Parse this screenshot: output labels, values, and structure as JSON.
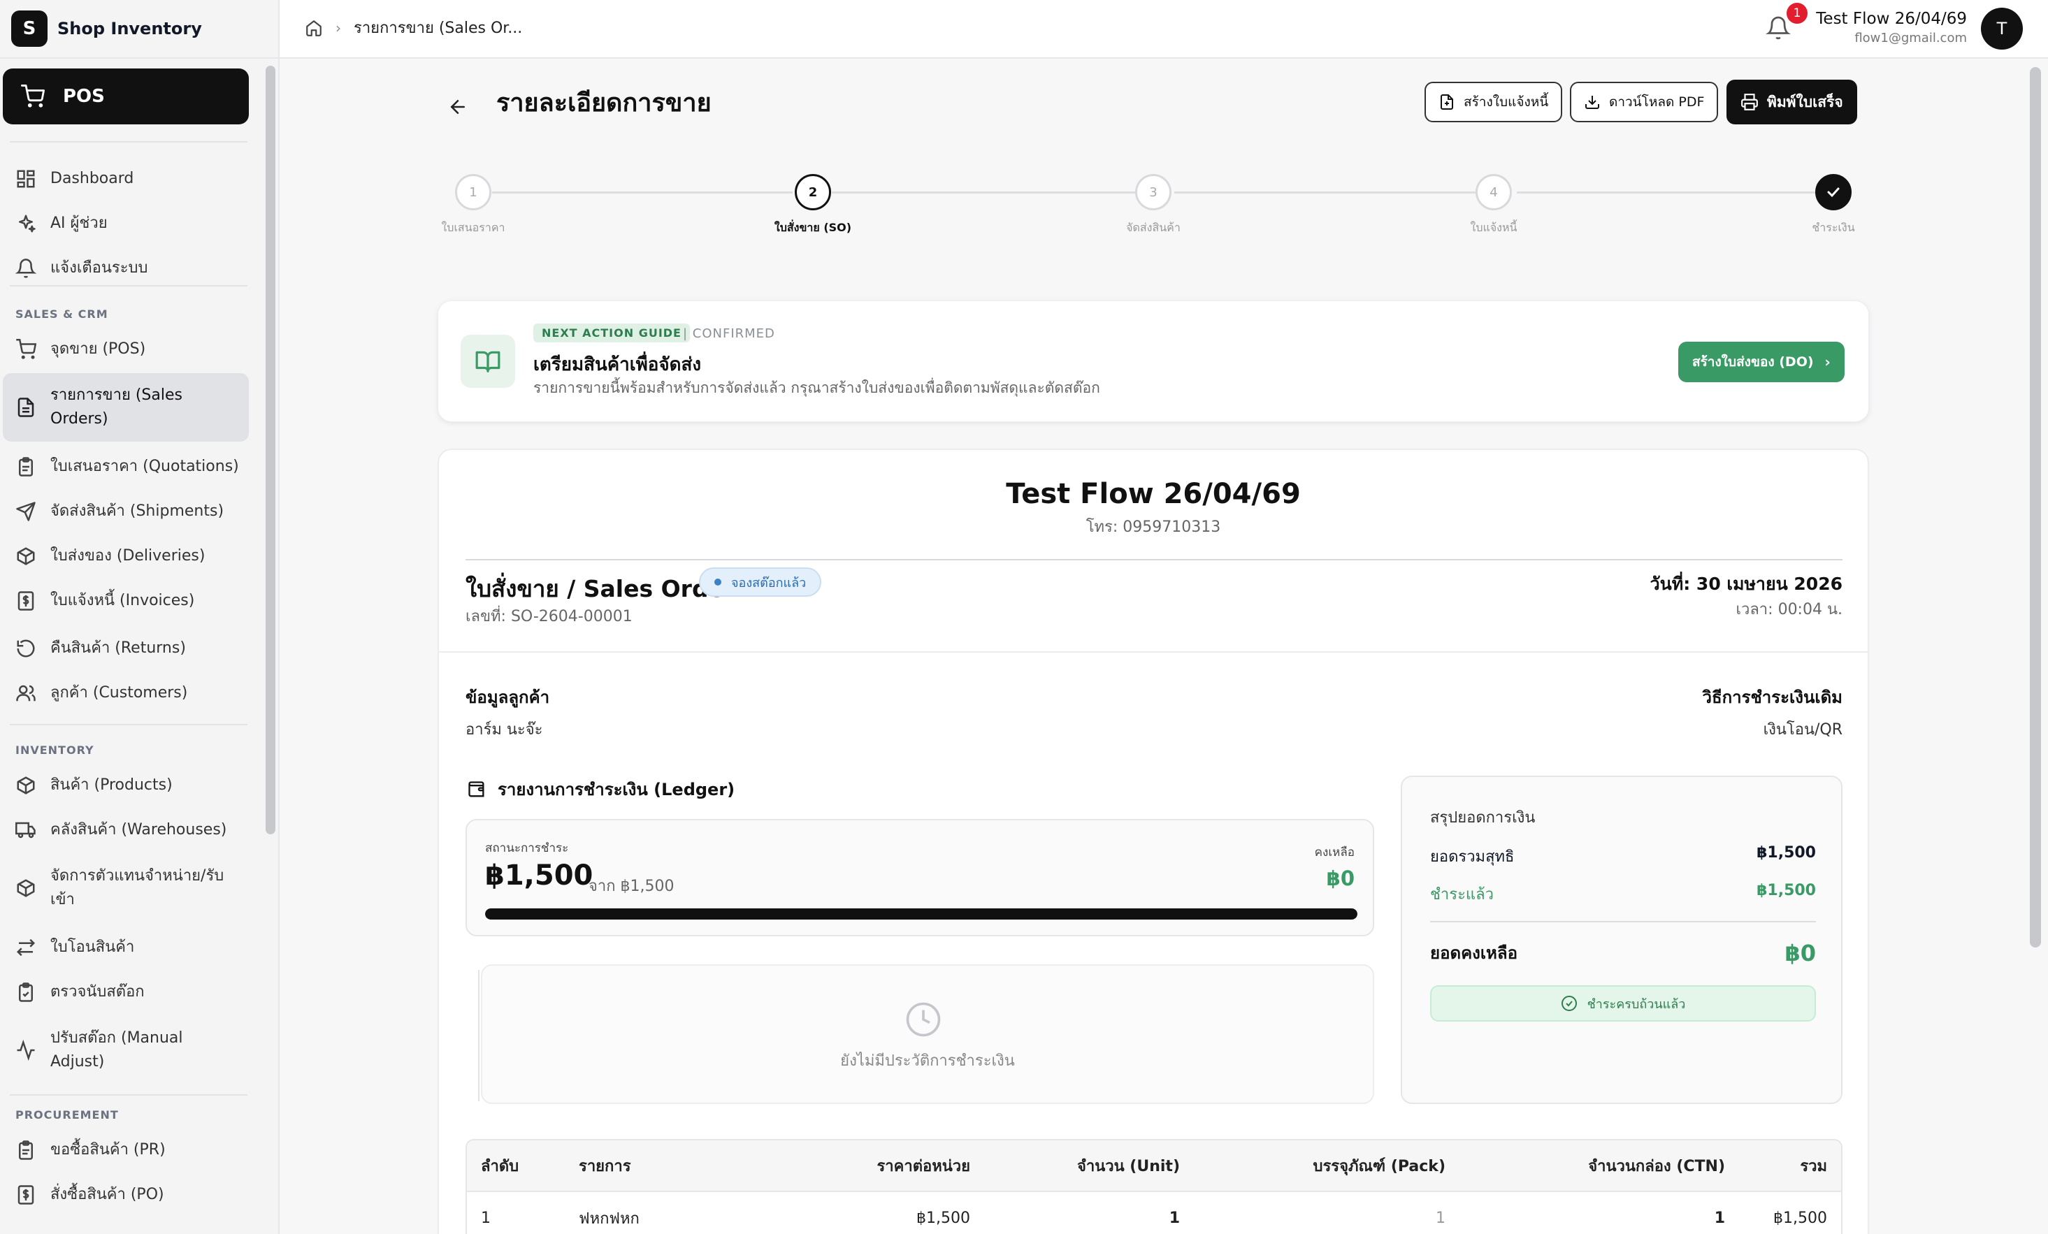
{
  "app": {
    "logo_letter": "S",
    "name": "Shop Inventory"
  },
  "sidebar": {
    "pos_label": "POS",
    "items_top": [
      {
        "label": "Dashboard"
      },
      {
        "label": "AI ผู้ช่วย"
      },
      {
        "label": "แจ้งเตือนระบบ"
      }
    ],
    "sections": {
      "sales": "SALES & CRM",
      "inventory": "INVENTORY",
      "procurement": "PROCUREMENT"
    },
    "sales_items": [
      {
        "label": "จุดขาย (POS)"
      },
      {
        "label": "รายการขาย (Sales Orders)"
      },
      {
        "label": "ใบเสนอราคา (Quotations)"
      },
      {
        "label": "จัดส่งสินค้า (Shipments)"
      },
      {
        "label": "ใบส่งของ (Deliveries)"
      },
      {
        "label": "ใบแจ้งหนี้ (Invoices)"
      },
      {
        "label": "คืนสินค้า (Returns)"
      },
      {
        "label": "ลูกค้า (Customers)"
      }
    ],
    "inventory_items": [
      {
        "label": "สินค้า (Products)"
      },
      {
        "label": "คลังสินค้า (Warehouses)"
      },
      {
        "label": "จัดการตัวแทนจำหน่าย/รับเข้า"
      },
      {
        "label": "ใบโอนสินค้า"
      },
      {
        "label": "ตรวจนับสต๊อก"
      },
      {
        "label": "ปรับสต๊อก (Manual Adjust)"
      }
    ],
    "procurement_items": [
      {
        "label": "ขอซื้อสินค้า (PR)"
      },
      {
        "label": "สั่งซื้อสินค้า (PO)"
      }
    ]
  },
  "topbar": {
    "breadcrumb": "รายการขาย (Sales Or...",
    "notifications_count": "1",
    "user_name": "Test Flow 26/04/69",
    "user_email": "flow1@gmail.com",
    "avatar_letter": "T"
  },
  "page": {
    "title": "รายละเอียดการขาย",
    "buttons": {
      "create_invoice": "สร้างใบแจ้งหนี้",
      "download_pdf": "ดาวน์โหลด PDF",
      "print_receipt": "พิมพ์ใบเสร็จ"
    }
  },
  "stepper": {
    "steps": [
      {
        "num": "1",
        "label": "ใบเสนอราคา"
      },
      {
        "num": "2",
        "label": "ใบสั่งขาย (SO)"
      },
      {
        "num": "3",
        "label": "จัดส่งสินค้า"
      },
      {
        "num": "4",
        "label": "ใบแจ้งหนี้"
      },
      {
        "num": "",
        "label": "ชำระเงิน"
      }
    ],
    "current_index": 1
  },
  "guide": {
    "tag": "NEXT ACTION GUIDE",
    "status": "| CONFIRMED",
    "title": "เตรียมสินค้าเพื่อจัดส่ง",
    "description": "รายการขายนี้พร้อมสำหรับการจัดส่งแล้ว กรุณาสร้างใบส่งของเพื่อติดตามพัสดุและตัดสต๊อก",
    "button": "สร้างใบส่งของ (DO)"
  },
  "document": {
    "customer_title": "Test Flow 26/04/69",
    "phone": "โทร: 0959710313",
    "type_title": "ใบสั่งขาย / Sales Order",
    "badge": "จองสต๊อกแล้ว",
    "number": "เลขที่: SO-2604-00001",
    "date": "วันที่: 30 เมษายน 2026",
    "time": "เวลา: 00:04 น.",
    "customer_info_label": "ข้อมูลลูกค้า",
    "customer_name": "อาร์ม นะจ๊ะ",
    "payment_method_label": "วิธีการชำระเงินเดิม",
    "payment_method": "เงินโอน/QR"
  },
  "ledger": {
    "title": "รายงานการชำระเงิน (Ledger)",
    "status_label": "สถานะการชำระ",
    "paid_amount": "฿1,500",
    "of_total": "จาก ฿1,500",
    "remaining_label": "คงเหลือ",
    "remaining_value": "฿0",
    "progress": 1.0,
    "empty_history": "ยังไม่มีประวัติการชำระเงิน"
  },
  "summary": {
    "title": "สรุปยอดการเงิน",
    "net_label": "ยอดรวมสุทธิ",
    "net_value": "฿1,500",
    "paid_label": "ชำระแล้ว",
    "paid_value": "฿1,500",
    "balance_label": "ยอดคงเหลือ",
    "balance_value": "฿0",
    "paid_badge": "ชำระครบถ้วนแล้ว"
  },
  "table": {
    "headers": [
      "ลำดับ",
      "รายการ",
      "ราคาต่อหน่วย",
      "จำนวน (Unit)",
      "บรรจุภัณฑ์ (Pack)",
      "จำนวนกล่อง (CTN)",
      "รวม"
    ],
    "rows": [
      [
        "1",
        "ฟหกฟหก",
        "฿1,500",
        "1",
        "1",
        "1",
        "฿1,500"
      ]
    ]
  },
  "colors": {
    "accent_green": "#3a9a66",
    "dark": "#111111",
    "badge_blue": "#2b6cb0",
    "notify_red": "#e11d2e"
  }
}
